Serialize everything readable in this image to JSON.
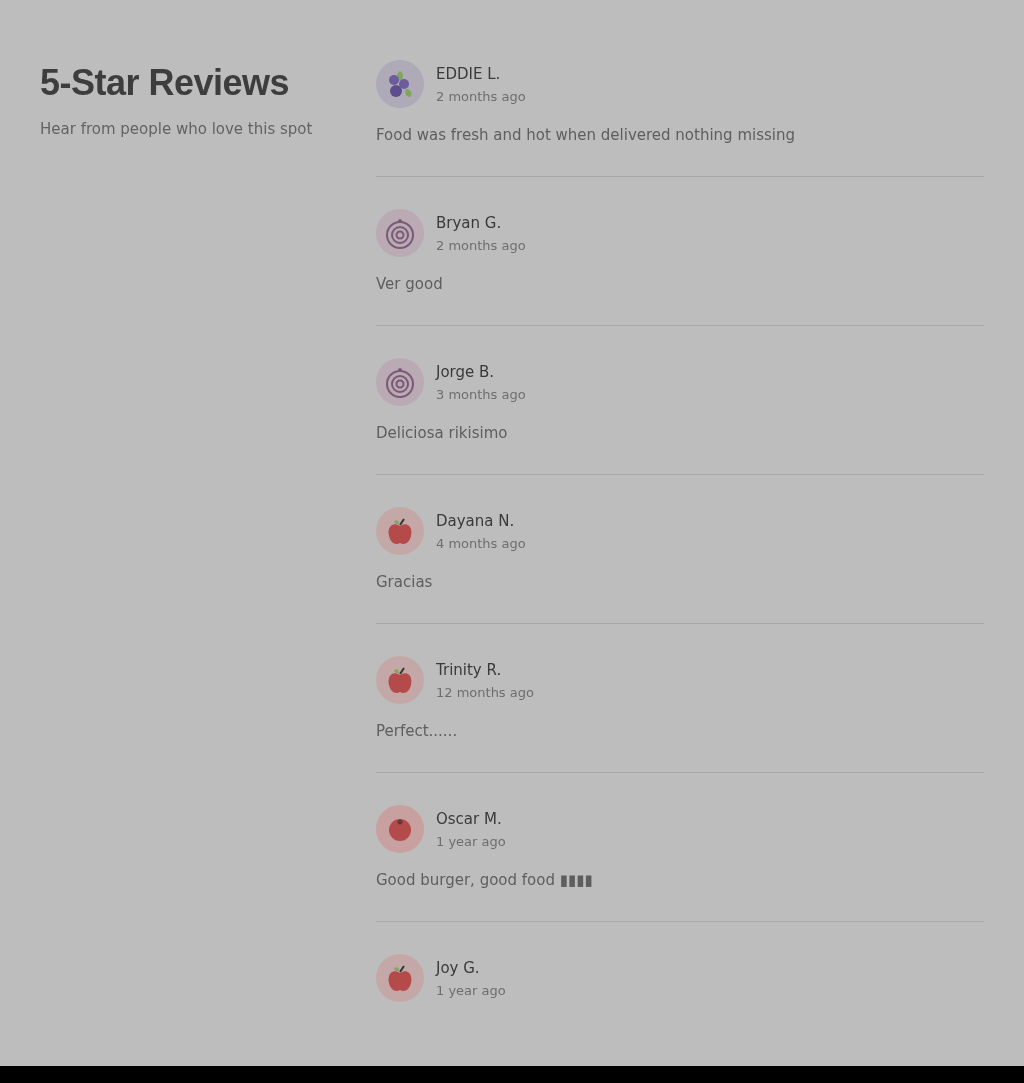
{
  "header": {
    "title": "5-Star Reviews",
    "subtitle": "Hear from people who love this spot"
  },
  "reviews": [
    {
      "name": "EDDIE L.",
      "time": "2 months ago",
      "text": "Food was fresh and hot when delivered nothing missing",
      "kind": "berries"
    },
    {
      "name": "Bryan G.",
      "time": "2 months ago",
      "text": "Ver good",
      "kind": "onion"
    },
    {
      "name": "Jorge B.",
      "time": "3 months ago",
      "text": "Deliciosa rikisimo",
      "kind": "onion"
    },
    {
      "name": "Dayana N.",
      "time": "4 months ago",
      "text": "Gracias",
      "kind": "apple"
    },
    {
      "name": "Trinity R.",
      "time": "12 months ago",
      "text": "Perfect......",
      "kind": "apple"
    },
    {
      "name": "Oscar M.",
      "time": "1 year ago",
      "text": "Good burger, good food ▮▮▮▮",
      "kind": "tomato"
    },
    {
      "name": "Joy G.",
      "time": "1 year ago",
      "kind": "apple"
    }
  ]
}
